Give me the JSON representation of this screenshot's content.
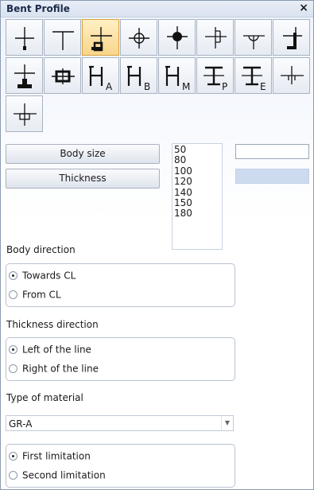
{
  "window": {
    "title": "Bent Profile",
    "close_glyph": "×"
  },
  "toolbar": {
    "tools": [
      {
        "icon": "profile-plain-bar-icon",
        "subscript": ""
      },
      {
        "icon": "profile-t-bar-icon",
        "subscript": ""
      },
      {
        "icon": "profile-angle-flange-icon",
        "subscript": ""
      },
      {
        "icon": "profile-round-bar-icon",
        "subscript": ""
      },
      {
        "icon": "profile-bulb-bar-icon",
        "subscript": ""
      },
      {
        "icon": "profile-half-round-icon",
        "subscript": ""
      },
      {
        "icon": "profile-half-pipe-icon",
        "subscript": ""
      },
      {
        "icon": "profile-z-bar-icon",
        "subscript": ""
      },
      {
        "icon": "profile-flat-bulb-icon",
        "subscript": ""
      },
      {
        "icon": "profile-rect-tube-icon",
        "subscript": ""
      },
      {
        "icon": "profile-channel-a-icon",
        "subscript": "A"
      },
      {
        "icon": "profile-channel-b-icon",
        "subscript": "B"
      },
      {
        "icon": "profile-channel-m-icon",
        "subscript": "M"
      },
      {
        "icon": "profile-i-beam-p-icon",
        "subscript": "P"
      },
      {
        "icon": "profile-i-beam-e-icon",
        "subscript": "E"
      },
      {
        "icon": "profile-rail-icon",
        "subscript": ""
      },
      {
        "icon": "profile-box-plate-icon",
        "subscript": ""
      }
    ],
    "selected_index": 2
  },
  "buttons": {
    "body_size": "Body size",
    "thickness": "Thickness"
  },
  "size_list": [
    "50",
    "80",
    "100",
    "120",
    "140",
    "150",
    "180"
  ],
  "body_direction": {
    "label": "Body direction",
    "options": [
      "Towards CL",
      "From CL"
    ],
    "selected": 0
  },
  "thickness_direction": {
    "label": "Thickness direction",
    "options": [
      "Left of the line",
      "Right of the line"
    ],
    "selected": 0
  },
  "material": {
    "label": "Type of material",
    "value": "GR-A",
    "arrow_glyph": "▼"
  },
  "limitation": {
    "options": [
      "First limitation",
      "Second limitation"
    ],
    "selected": 0
  }
}
